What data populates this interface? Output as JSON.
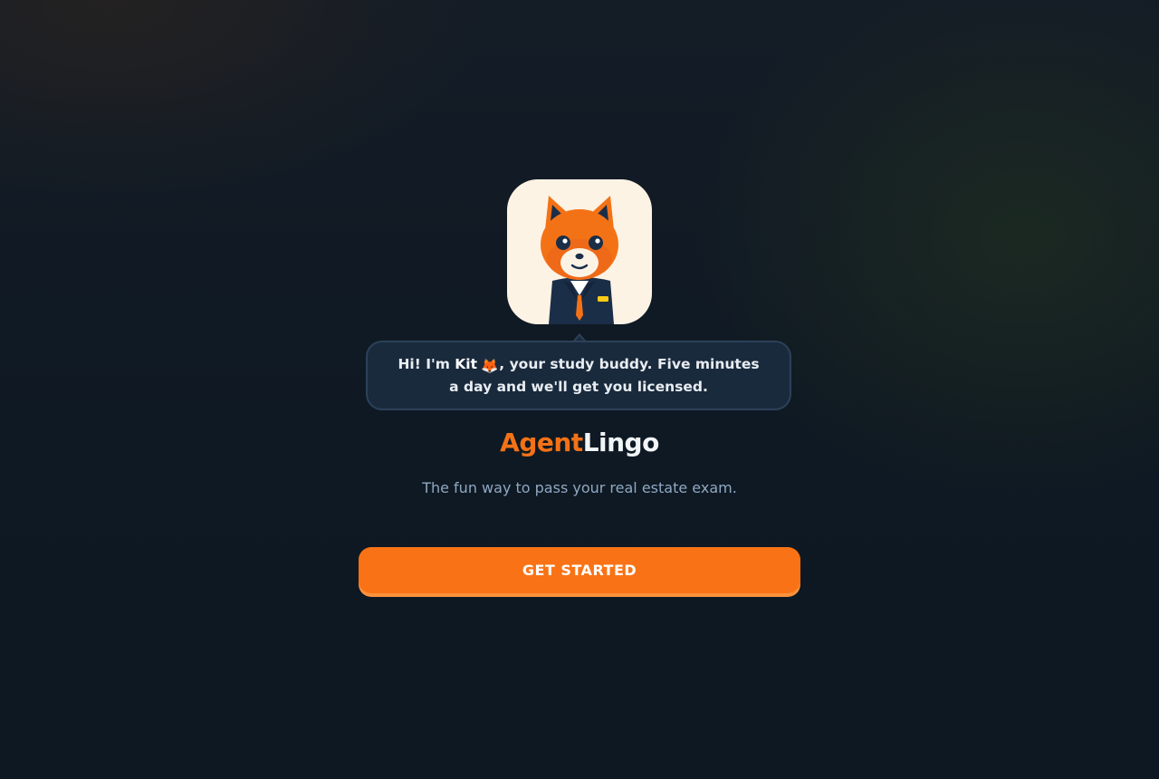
{
  "mascot": {
    "name": "Kit",
    "icon": "fox-agent-mascot"
  },
  "bubble": {
    "greeting_prefix": "Hi! I'm ",
    "mascot_name": "Kit",
    "emoji": "🦊",
    "greeting_suffix": ", your study buddy. Five minutes a day and we'll get you licensed."
  },
  "brand": {
    "part1": "Agent",
    "part2": "Lingo",
    "accent_color": "#f47216"
  },
  "tagline": "The fun way to pass your real estate exam.",
  "cta": {
    "label": "GET STARTED",
    "color": "#f97316"
  }
}
